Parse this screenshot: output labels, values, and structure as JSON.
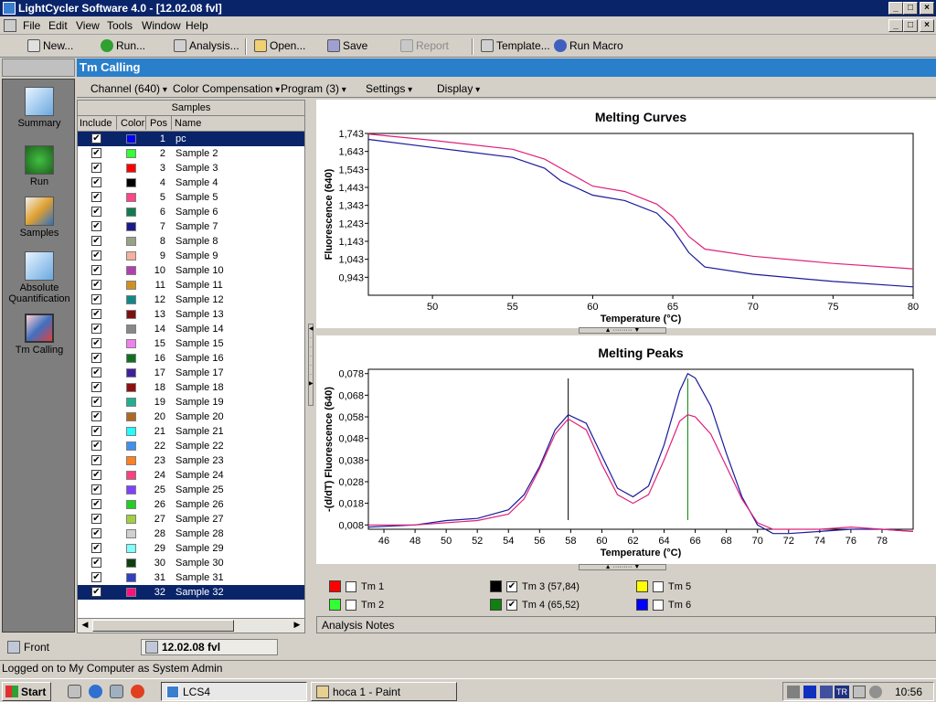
{
  "window": {
    "title": "LightCycler Software 4.0 - [12.02.08 fvl]"
  },
  "menu": [
    "File",
    "Edit",
    "View",
    "Tools",
    "Window",
    "Help"
  ],
  "toolbar": {
    "new": "New...",
    "run": "Run...",
    "analysis": "Analysis...",
    "open": "Open...",
    "save": "Save",
    "report": "Report",
    "template": "Template...",
    "macro": "Run Macro"
  },
  "nav": {
    "items": [
      "Summary",
      "Run",
      "Samples",
      "Absolute Quantification",
      "Tm Calling"
    ]
  },
  "module": {
    "title": "Tm Calling"
  },
  "subtoolbar": {
    "channel": "Channel (640)",
    "color_comp": "Color Compensation",
    "program": "Program (3)",
    "settings": "Settings",
    "display": "Display"
  },
  "samples": {
    "header": "Samples",
    "columns": [
      "Include",
      "Color",
      "Pos",
      "Name"
    ],
    "rows": [
      {
        "pos": "1",
        "name": "pc",
        "color": "#0000ff",
        "selected": true
      },
      {
        "pos": "2",
        "name": "Sample 2",
        "color": "#33ff33"
      },
      {
        "pos": "3",
        "name": "Sample 3",
        "color": "#ff0000"
      },
      {
        "pos": "4",
        "name": "Sample 4",
        "color": "#000000"
      },
      {
        "pos": "5",
        "name": "Sample 5",
        "color": "#ff4488"
      },
      {
        "pos": "6",
        "name": "Sample 6",
        "color": "#127a50"
      },
      {
        "pos": "7",
        "name": "Sample 7",
        "color": "#1a1a8a"
      },
      {
        "pos": "8",
        "name": "Sample 8",
        "color": "#99a088"
      },
      {
        "pos": "9",
        "name": "Sample 9",
        "color": "#f4b0a0"
      },
      {
        "pos": "10",
        "name": "Sample 10",
        "color": "#b040b0"
      },
      {
        "pos": "11",
        "name": "Sample 11",
        "color": "#d09020"
      },
      {
        "pos": "12",
        "name": "Sample 12",
        "color": "#108888"
      },
      {
        "pos": "13",
        "name": "Sample 13",
        "color": "#801010"
      },
      {
        "pos": "14",
        "name": "Sample 14",
        "color": "#888888"
      },
      {
        "pos": "15",
        "name": "Sample 15",
        "color": "#f080f0"
      },
      {
        "pos": "16",
        "name": "Sample 16",
        "color": "#107020"
      },
      {
        "pos": "17",
        "name": "Sample 17",
        "color": "#4020a0"
      },
      {
        "pos": "18",
        "name": "Sample 18",
        "color": "#901010"
      },
      {
        "pos": "19",
        "name": "Sample 19",
        "color": "#20b090"
      },
      {
        "pos": "20",
        "name": "Sample 20",
        "color": "#b06820"
      },
      {
        "pos": "21",
        "name": "Sample 21",
        "color": "#20ffff"
      },
      {
        "pos": "22",
        "name": "Sample 22",
        "color": "#4090f0"
      },
      {
        "pos": "23",
        "name": "Sample 23",
        "color": "#ff8020"
      },
      {
        "pos": "24",
        "name": "Sample 24",
        "color": "#ff4080"
      },
      {
        "pos": "25",
        "name": "Sample 25",
        "color": "#8040ff"
      },
      {
        "pos": "26",
        "name": "Sample 26",
        "color": "#20d020"
      },
      {
        "pos": "27",
        "name": "Sample 27",
        "color": "#a0d040"
      },
      {
        "pos": "28",
        "name": "Sample 28",
        "color": "#d0d0d0"
      },
      {
        "pos": "29",
        "name": "Sample 29",
        "color": "#80ffff"
      },
      {
        "pos": "30",
        "name": "Sample 30",
        "color": "#104010"
      },
      {
        "pos": "31",
        "name": "Sample 31",
        "color": "#3040c0"
      },
      {
        "pos": "32",
        "name": "Sample 32",
        "color": "#ff1080",
        "selected": true
      }
    ]
  },
  "chart_data": [
    {
      "type": "line",
      "title": "Melting Curves",
      "xlabel": "Temperature (°C)",
      "ylabel": "Fluorescence (640)",
      "xlim": [
        46,
        80
      ],
      "ylim": [
        0.843,
        1.743
      ],
      "xticks": [
        "50",
        "55",
        "60",
        "65",
        "70",
        "75",
        "80"
      ],
      "xtick_values": [
        50,
        55,
        60,
        65,
        70,
        75,
        80
      ],
      "yticks": [
        "1,743",
        "1,643",
        "1,543",
        "1,443",
        "1,343",
        "1,243",
        "1,143",
        "1,043",
        "0,943"
      ],
      "ytick_values": [
        1.743,
        1.643,
        1.543,
        1.443,
        1.343,
        1.243,
        1.143,
        1.043,
        0.943
      ],
      "series": [
        {
          "color": "#e0207a",
          "x": [
            46,
            50,
            55,
            57,
            58,
            60,
            62,
            64,
            65,
            66,
            67,
            70,
            75,
            80
          ],
          "y": [
            1.74,
            1.705,
            1.655,
            1.6,
            1.55,
            1.45,
            1.42,
            1.35,
            1.28,
            1.17,
            1.1,
            1.06,
            1.02,
            0.99
          ]
        },
        {
          "color": "#1a1a9a",
          "x": [
            46,
            50,
            55,
            57,
            58,
            60,
            62,
            64,
            65,
            66,
            67,
            70,
            75,
            80
          ],
          "y": [
            1.71,
            1.665,
            1.61,
            1.55,
            1.48,
            1.4,
            1.37,
            1.3,
            1.21,
            1.08,
            1.0,
            0.96,
            0.92,
            0.89
          ]
        }
      ]
    },
    {
      "type": "line",
      "title": "Melting Peaks",
      "xlabel": "Temperature (°C)",
      "ylabel": "-(d/dT) Fluorescence (640)",
      "xlim": [
        45,
        80
      ],
      "ylim": [
        0.006,
        0.08
      ],
      "xticks": [
        "46",
        "48",
        "50",
        "52",
        "54",
        "56",
        "58",
        "60",
        "62",
        "64",
        "66",
        "68",
        "70",
        "72",
        "74",
        "76",
        "78"
      ],
      "xtick_values": [
        46,
        48,
        50,
        52,
        54,
        56,
        58,
        60,
        62,
        64,
        66,
        68,
        70,
        72,
        74,
        76,
        78
      ],
      "yticks": [
        "0,078",
        "0,068",
        "0,058",
        "0,048",
        "0,038",
        "0,028",
        "0,018",
        "0,008"
      ],
      "ytick_values": [
        0.078,
        0.068,
        0.058,
        0.048,
        0.038,
        0.028,
        0.018,
        0.008
      ],
      "vlines": [
        {
          "x": 57.84,
          "color": "#000000"
        },
        {
          "x": 65.52,
          "color": "#008800"
        }
      ],
      "series": [
        {
          "color": "#1a1a9a",
          "x": [
            45,
            48,
            50,
            52,
            54,
            55,
            56,
            57,
            57.84,
            59,
            60,
            61,
            62,
            63,
            64,
            65,
            65.52,
            66,
            67,
            68,
            69,
            70,
            71,
            72,
            74,
            76,
            78,
            80
          ],
          "y": [
            0.007,
            0.008,
            0.01,
            0.011,
            0.015,
            0.022,
            0.035,
            0.052,
            0.059,
            0.055,
            0.04,
            0.025,
            0.021,
            0.026,
            0.045,
            0.07,
            0.078,
            0.076,
            0.063,
            0.041,
            0.021,
            0.008,
            0.004,
            0.004,
            0.005,
            0.006,
            0.006,
            0.005
          ]
        },
        {
          "color": "#e0207a",
          "x": [
            45,
            48,
            50,
            52,
            54,
            55,
            56,
            57,
            57.84,
            59,
            60,
            61,
            62,
            63,
            64,
            65,
            65.52,
            66,
            67,
            68,
            69,
            70,
            71,
            72,
            74,
            76,
            78,
            80
          ],
          "y": [
            0.008,
            0.008,
            0.009,
            0.01,
            0.013,
            0.02,
            0.034,
            0.05,
            0.057,
            0.052,
            0.036,
            0.022,
            0.018,
            0.022,
            0.038,
            0.056,
            0.059,
            0.058,
            0.05,
            0.035,
            0.02,
            0.009,
            0.006,
            0.006,
            0.006,
            0.007,
            0.006,
            0.005
          ]
        }
      ]
    }
  ],
  "legend": [
    {
      "label": "Tm 1",
      "color": "#ff0000",
      "checked": false
    },
    {
      "label": "Tm 2",
      "color": "#33ff33",
      "checked": false
    },
    {
      "label": "Tm 3 (57,84)",
      "color": "#000000",
      "checked": true
    },
    {
      "label": "Tm 4 (65,52)",
      "color": "#108010",
      "checked": true
    },
    {
      "label": "Tm 5",
      "color": "#ffff00",
      "checked": false
    },
    {
      "label": "Tm 6",
      "color": "#0000ff",
      "checked": false
    }
  ],
  "analysis_notes": "Analysis Notes",
  "bottom_tabs": {
    "front": "Front",
    "doc": "12.02.08 fvl"
  },
  "status": "Logged on to My Computer as System Admin",
  "taskbar": {
    "start": "Start",
    "tasks": [
      "LCS4",
      "hoca 1 - Paint"
    ],
    "clock": "10:56",
    "tray_tr": "TR"
  }
}
